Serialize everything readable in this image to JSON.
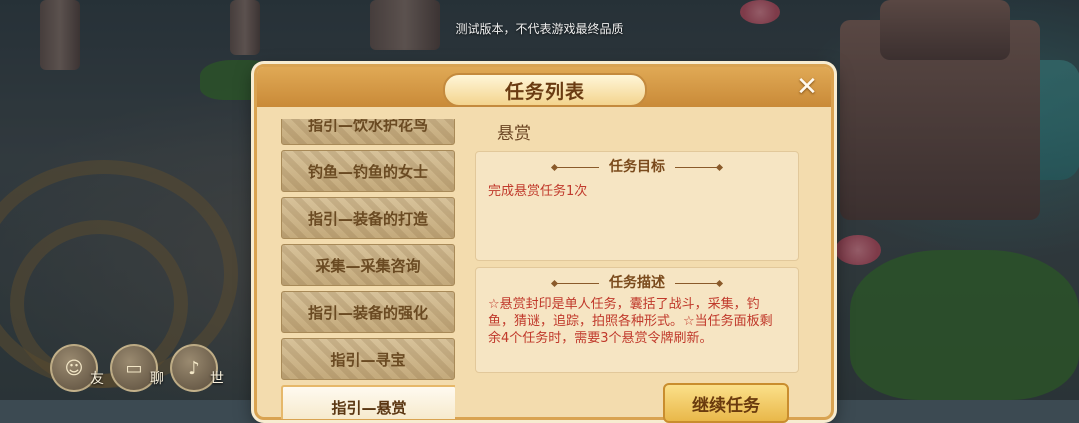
{
  "notice": "测试版本，不代表游戏最终品质",
  "dialog": {
    "title": "任务列表",
    "close_label": "✕"
  },
  "quest_list": [
    {
      "label": "指引—饮水护花鸟",
      "active": false
    },
    {
      "label": "钓鱼—钓鱼的女士",
      "active": false
    },
    {
      "label": "指引—装备的打造",
      "active": false
    },
    {
      "label": "采集—采集咨询",
      "active": false
    },
    {
      "label": "指引—装备的强化",
      "active": false
    },
    {
      "label": "指引—寻宝",
      "active": false
    },
    {
      "label": "指引—悬赏",
      "active": true
    }
  ],
  "detail": {
    "title": "悬赏",
    "goal_header": "任务目标",
    "goal_text": "完成悬赏任务1次",
    "desc_header": "任务描述",
    "desc_text": "☆悬赏封印是单人任务，囊括了战斗，采集，钓鱼，猜谜，追踪，拍照各种形式。☆当任务面板剩余4个任务时，需要3个悬赏令牌刷新。",
    "continue_label": "继续任务"
  },
  "social": [
    {
      "icon": "face-icon",
      "glyph": "☺",
      "label": "友"
    },
    {
      "icon": "chat-icon",
      "glyph": "▭",
      "label": "聊"
    },
    {
      "icon": "microphone-icon",
      "glyph": "♪",
      "label": "世"
    }
  ]
}
